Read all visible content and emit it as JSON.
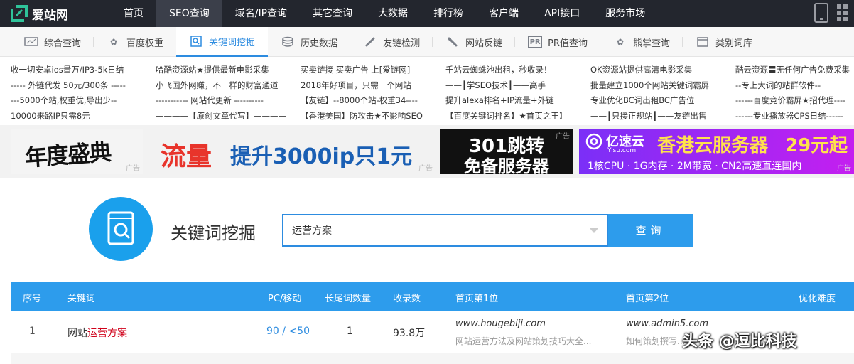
{
  "brand": {
    "name": "爱站网"
  },
  "nav": [
    "首页",
    "SEO查询",
    "域名/IP查询",
    "其它查询",
    "大数据",
    "排行榜",
    "客户端",
    "API接口",
    "服务市场"
  ],
  "subnav": [
    {
      "label": "综合查询",
      "icon": "monitor-icon"
    },
    {
      "label": "百度权重",
      "icon": "paw-icon"
    },
    {
      "label": "关键词挖掘",
      "icon": "keyword-search-icon"
    },
    {
      "label": "历史数据",
      "icon": "database-icon"
    },
    {
      "label": "友链检测",
      "icon": "link-icon"
    },
    {
      "label": "网站反链",
      "icon": "backlink-icon"
    },
    {
      "label": "PR值查询",
      "icon": "pr-icon"
    },
    {
      "label": "熊掌查询",
      "icon": "bear-paw-icon"
    },
    {
      "label": "类别词库",
      "icon": "category-icon"
    }
  ],
  "ad_text": [
    [
      "收一切安卓ios量万/IP3-5k日结",
      "----- 外链代发 50元/300条 -----",
      "---5000个站,权重优,导出少--",
      "10000来路IP只需8元"
    ],
    [
      "哈酷资源站★提供最新电影采集",
      "小飞国外网赚，不一样的财富通道",
      "----------- 网站代更新 ----------",
      "————【原创文章代写】————"
    ],
    [
      "买卖链接 买卖广告 上[爱链网]",
      "2018年好项目，只需一个网站",
      "【友链】--8000个站-权重34----",
      "【香港美国】防攻击★不影响SEO"
    ],
    [
      "千站云蜘蛛池出租，秒收录！",
      "——┃学SEO技术┃——高手",
      "提升alexa排名+IP流量+外链",
      "【百度关键词排名】★首页之王】"
    ],
    [
      "OK资源站提供高清电影采集",
      "批量建立1000个网站关键词霸屏",
      "专业优化BC词出租BC广告位",
      "——┃只接正规站┃——友链出售"
    ],
    [
      "酷云资源〓无任何广告免费采集",
      "--专上大词的站群软件--",
      "------百度竞价霸屏★招代理----",
      "------专业播放器CPS日结------"
    ]
  ],
  "banners": {
    "b1": "年度盛典",
    "b2a": "流量",
    "b2b": "提升3000ip只1元",
    "b3a": "301跳转",
    "b3b": "免备服务器",
    "b4brand": "亿速云",
    "b4domain": "Yisu.com",
    "b4title": "香港云服务器",
    "b4price": "29元起",
    "b4spec": "1核CPU · 1G内存 · 2M带宽 · CN2高速直连国内",
    "ad_tag": "广告"
  },
  "search": {
    "title": "关键词挖掘",
    "value": "运营方案",
    "button": "查询"
  },
  "table": {
    "headers": [
      "序号",
      "关键词",
      "PC/移动",
      "长尾词数量",
      "收录数",
      "首页第1位",
      "首页第2位",
      "优化难度"
    ],
    "rows": [
      {
        "index": "1",
        "kw_prefix": "网站",
        "kw_hl": "运营方案",
        "pc_mobile": "90 / <50",
        "longtail": "1",
        "indexed": "93.8万",
        "first_url": "www.hougebiji.com",
        "first_desc": "网站运营方法及网站策划技巧大全...",
        "second_url": "www.admin5.com",
        "second_desc": "如何策划撰写..."
      }
    ]
  },
  "watermark": "头条 @逗比科技",
  "colors": {
    "topbar": "#23262e",
    "accent": "#2d9cec",
    "highlight": "#d0021b"
  }
}
